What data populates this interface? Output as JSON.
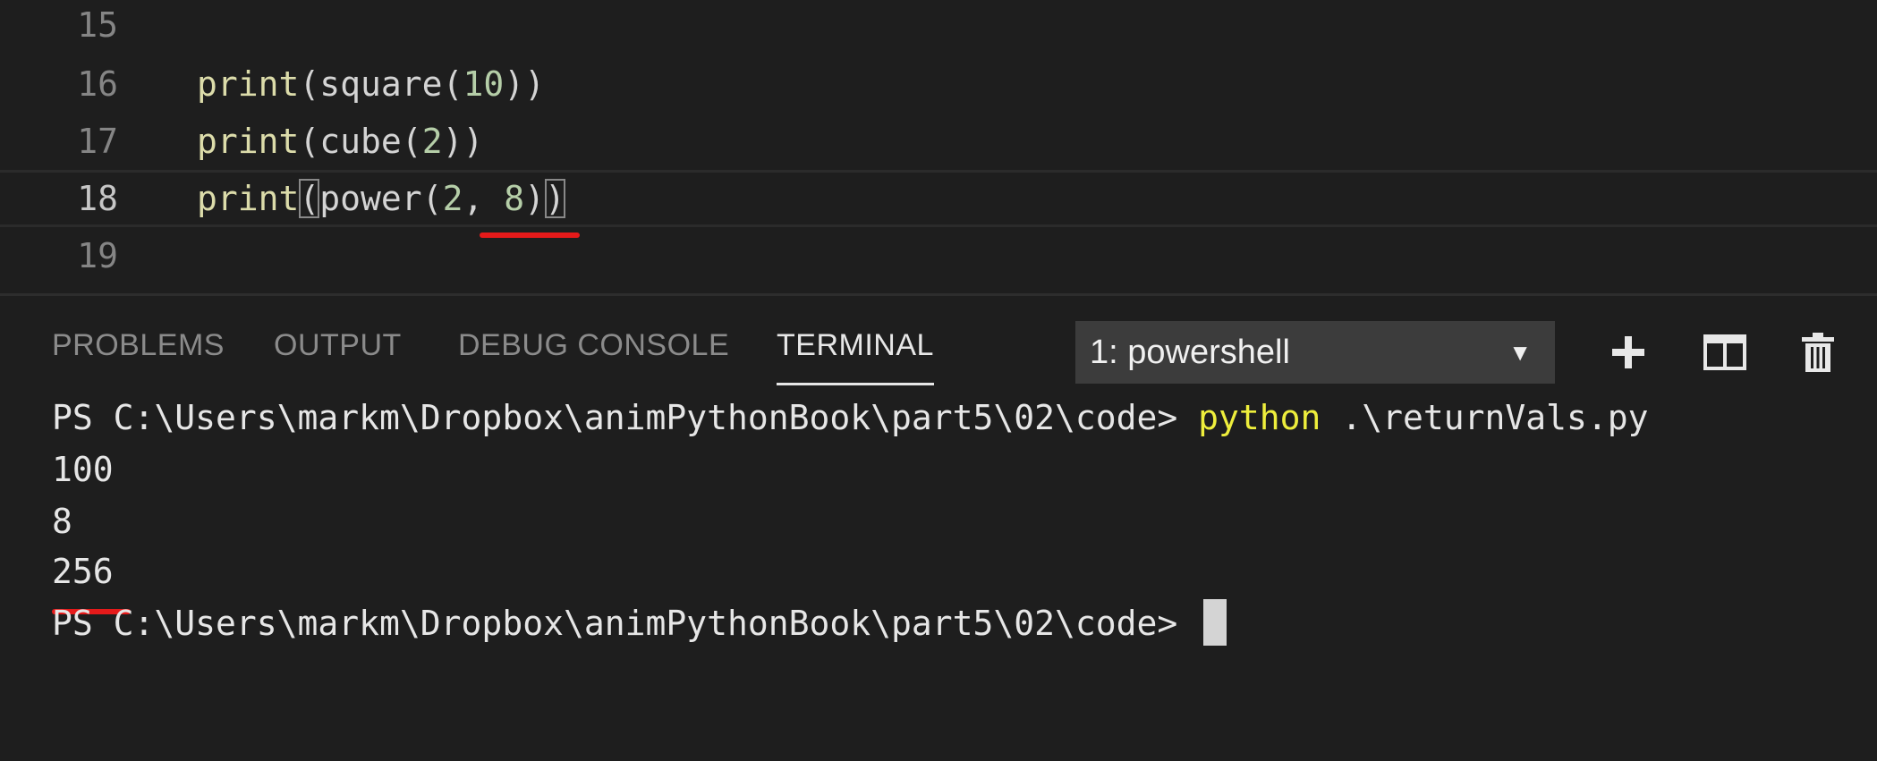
{
  "editor": {
    "lines": [
      {
        "num": "15",
        "fn": "",
        "open": "",
        "args": "",
        "close": ""
      },
      {
        "num": "16",
        "fn": "print",
        "inner_fn": "square",
        "arg1": "10"
      },
      {
        "num": "17",
        "fn": "print",
        "inner_fn": "cube",
        "arg1": "2"
      },
      {
        "num": "18",
        "fn": "print",
        "inner_fn": "power",
        "arg1": "2",
        "arg2": "8"
      },
      {
        "num": "19"
      }
    ]
  },
  "panel": {
    "tabs": [
      {
        "label": "PROBLEMS"
      },
      {
        "label": "OUTPUT"
      },
      {
        "label": "DEBUG CONSOLE"
      },
      {
        "label": "TERMINAL",
        "active": true
      }
    ],
    "shell_select": {
      "value": "1: powershell",
      "caret": "▼"
    },
    "actions": [
      "plus-icon",
      "split-terminal-icon",
      "trash-icon"
    ]
  },
  "terminal": {
    "prompt1": "PS C:\\Users\\markm\\Dropbox\\animPythonBook\\part5\\02\\code> ",
    "command_word": "python",
    "command_arg": " .\\returnVals.py",
    "outputs": [
      "100",
      "8",
      "256"
    ],
    "prompt2": "PS C:\\Users\\markm\\Dropbox\\animPythonBook\\part5\\02\\code> "
  },
  "colors": {
    "background": "#1e1e1e",
    "function": "#dcdcaa",
    "number": "#b5cea8",
    "command": "#eeee3c",
    "annotation_underline": "#e51a1a"
  }
}
